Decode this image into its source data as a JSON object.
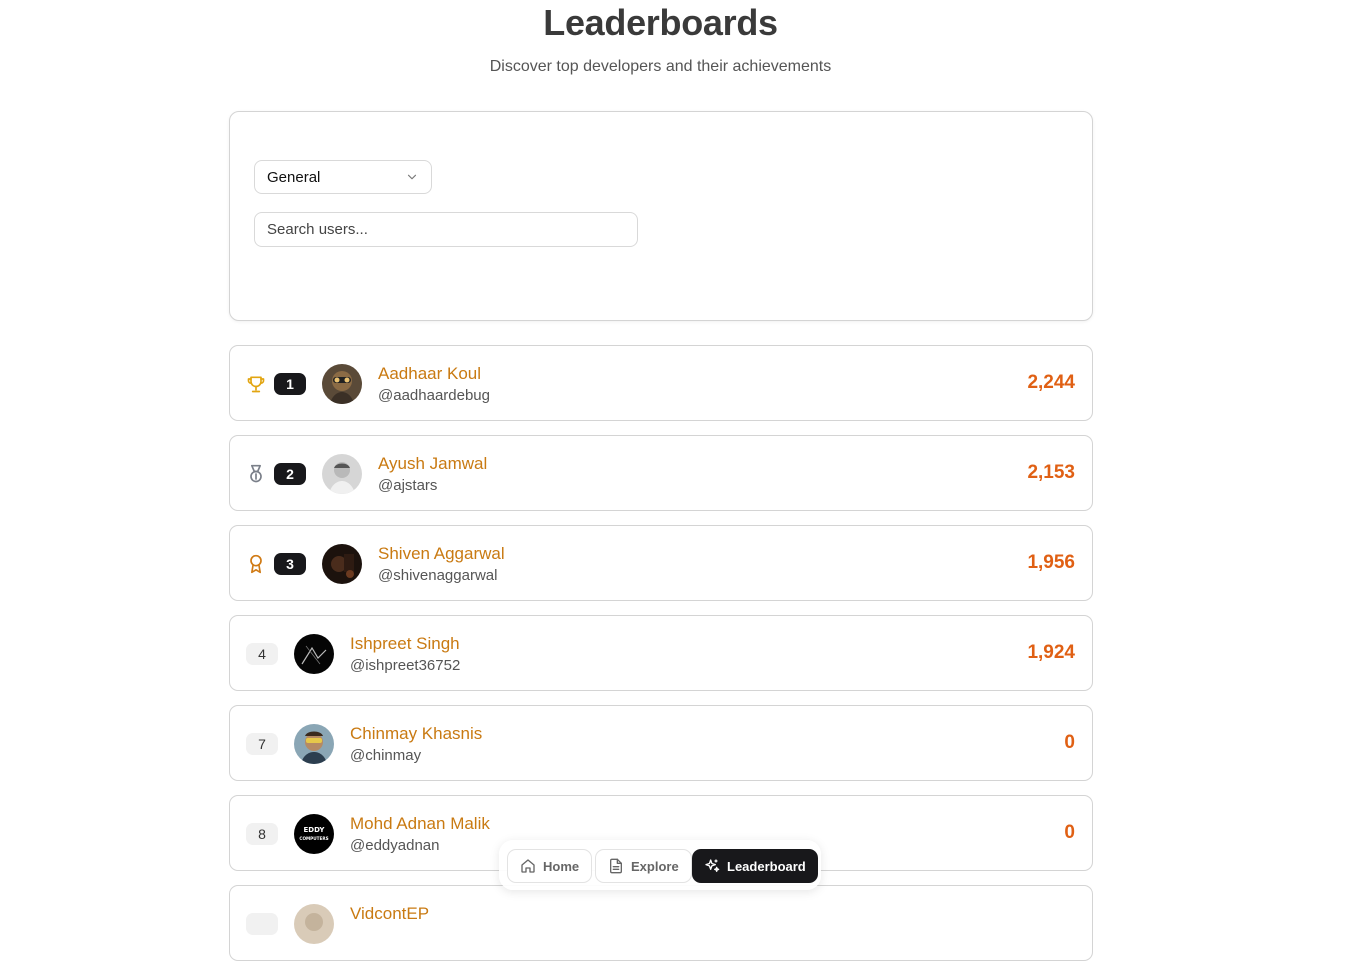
{
  "header": {
    "title": "Leaderboards",
    "subtitle": "Discover top developers and their achievements"
  },
  "filters": {
    "category_selected": "General",
    "search_placeholder": "Search users..."
  },
  "users": [
    {
      "rank": "1",
      "name": "Aadhaar Koul",
      "handle": "@aadhaardebug",
      "score": "2,244",
      "badge": "trophy-icon"
    },
    {
      "rank": "2",
      "name": "Ayush Jamwal",
      "handle": "@ajstars",
      "score": "2,153",
      "badge": "medal-icon"
    },
    {
      "rank": "3",
      "name": "Shiven Aggarwal",
      "handle": "@shivenaggarwal",
      "score": "1,956",
      "badge": "award-icon"
    },
    {
      "rank": "4",
      "name": "Ishpreet Singh",
      "handle": "@ishpreet36752",
      "score": "1,924"
    },
    {
      "rank": "7",
      "name": "Chinmay Khasnis",
      "handle": "@chinmay",
      "score": "0"
    },
    {
      "rank": "8",
      "name": "Mohd Adnan Malik",
      "handle": "@eddyadnan",
      "score": "0",
      "avatar_text": [
        "EDDY",
        "COMPUTERS"
      ]
    },
    {
      "rank": "",
      "name": "VidcontEP",
      "handle": "",
      "score": ""
    }
  ],
  "nav": {
    "home": "Home",
    "explore": "Explore",
    "leaderboard": "Leaderboard"
  },
  "colors": {
    "name": "#c97a12",
    "score": "#e06014",
    "gold": "#e2a511",
    "silver": "#7a7f89",
    "bronze": "#d07a14",
    "dark": "#18181b"
  }
}
